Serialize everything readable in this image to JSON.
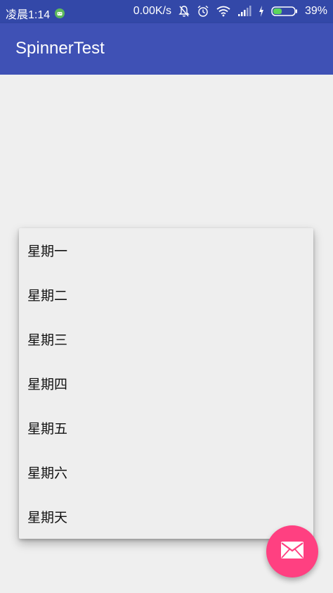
{
  "status_bar": {
    "time": "凌晨1:14",
    "network_speed": "0.00K/s",
    "battery_percent": "39%",
    "icons": [
      "android-notification-icon",
      "mute-icon",
      "alarm-icon",
      "wifi-icon",
      "signal-icon",
      "charging-icon",
      "battery-icon"
    ]
  },
  "app_bar": {
    "title": "SpinnerTest"
  },
  "spinner_dropdown": {
    "items": [
      "星期一",
      "星期二",
      "星期三",
      "星期四",
      "星期五",
      "星期六",
      "星期天"
    ]
  },
  "fab": {
    "icon": "mail-icon",
    "color": "#ff4081"
  },
  "colors": {
    "primary": "#3f51b5",
    "primary_dark": "#3348a8",
    "accent": "#ff4081"
  }
}
